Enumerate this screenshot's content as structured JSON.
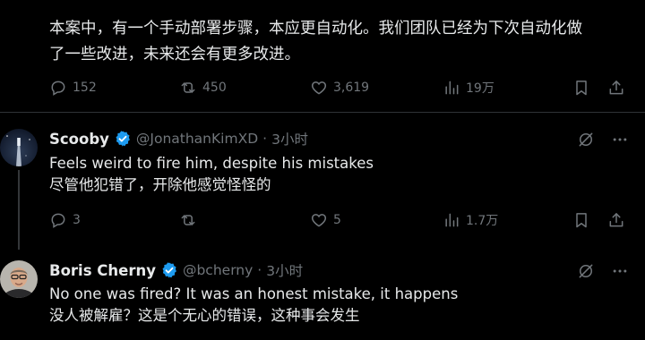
{
  "main_tweet": {
    "text_line1": "本案中，有一个手动部署步骤，本应更自动化。我们团队已经为下次自动化做",
    "text_line2": "了一些改进，未来还会有更多改进。",
    "replies_count": "152",
    "reposts_count": "450",
    "likes_count": "3,619",
    "views_count": "19万"
  },
  "replies": [
    {
      "name": "Scooby",
      "handle": "@JonathanKimXD",
      "separator": "·",
      "time": "3小时",
      "text_line1": "Feels weird to fire him, despite his mistakes",
      "text_line2": "尽管他犯错了，开除他感觉怪怪的",
      "replies_count": "3",
      "reposts_count": "",
      "likes_count": "5",
      "views_count": "1.7万"
    },
    {
      "name": "Boris Cherny",
      "handle": "@bcherny",
      "separator": "·",
      "time": "3小时",
      "text_line1": "No one was fired? It was an honest mistake, it happens",
      "text_line2": "没人被解雇？这是个无心的错误，这种事会发生"
    }
  ],
  "colors": {
    "background": "#000000",
    "text": "#e7e9ea",
    "muted": "#71767b",
    "divider": "#2f3336",
    "verified": "#1d9bf0"
  },
  "icons": [
    "reply-icon",
    "repost-icon",
    "like-icon",
    "views-icon",
    "bookmark-icon",
    "share-icon",
    "verified-icon",
    "grok-icon",
    "more-icon"
  ]
}
